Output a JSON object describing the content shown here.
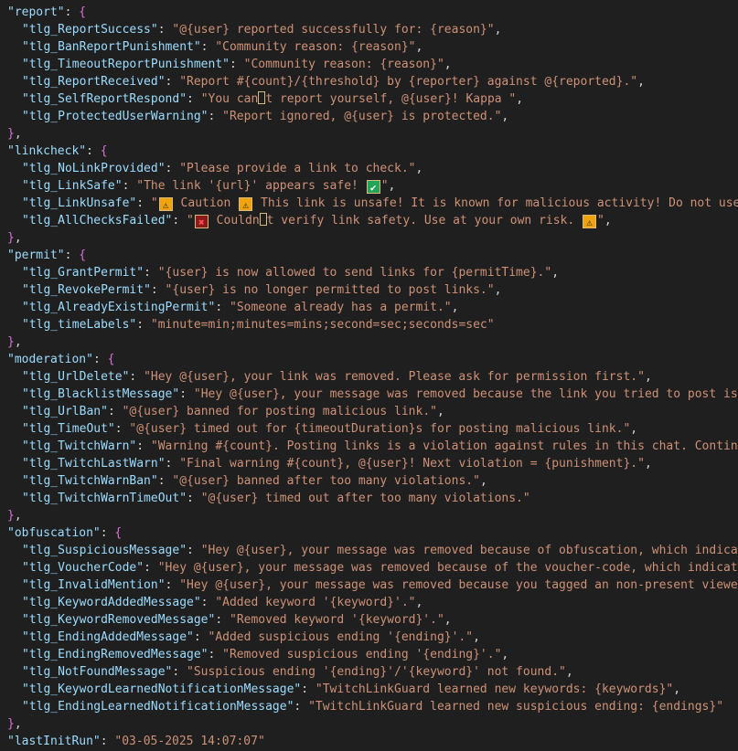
{
  "sections": [
    {
      "key": "report",
      "entries": [
        {
          "key": "tlg_ReportSuccess",
          "parts": [
            {
              "t": "text",
              "v": "@{user} reported successfully for: {reason}"
            }
          ]
        },
        {
          "key": "tlg_BanReportPunishment",
          "parts": [
            {
              "t": "text",
              "v": "Community reason: {reason}"
            }
          ]
        },
        {
          "key": "tlg_TimeoutReportPunishment",
          "parts": [
            {
              "t": "text",
              "v": "Community reason: {reason}"
            }
          ]
        },
        {
          "key": "tlg_ReportReceived",
          "parts": [
            {
              "t": "text",
              "v": "Report #{count}/{threshold} by {reporter} against @{reported}."
            }
          ]
        },
        {
          "key": "tlg_SelfReportRespond",
          "parts": [
            {
              "t": "text",
              "v": "You can"
            },
            {
              "t": "invisible",
              "icon": "invisible-char-icon"
            },
            {
              "t": "text",
              "v": "t report yourself, @{user}! Kappa "
            }
          ]
        },
        {
          "key": "tlg_ProtectedUserWarning",
          "parts": [
            {
              "t": "text",
              "v": "Report ignored, @{user} is protected."
            }
          ]
        }
      ]
    },
    {
      "key": "linkcheck",
      "entries": [
        {
          "key": "tlg_NoLinkProvided",
          "parts": [
            {
              "t": "text",
              "v": "Please provide a link to check."
            }
          ]
        },
        {
          "key": "tlg_LinkSafe",
          "parts": [
            {
              "t": "text",
              "v": "The link '{url}' appears safe! "
            },
            {
              "t": "emoji",
              "icon": "check-mark-icon",
              "glyph": "✔",
              "style": "check"
            }
          ]
        },
        {
          "key": "tlg_LinkUnsafe",
          "parts": [
            {
              "t": "emoji",
              "icon": "warning-icon",
              "glyph": "⚠",
              "style": "warn"
            },
            {
              "t": "text",
              "v": " Caution "
            },
            {
              "t": "emoji",
              "icon": "warning-icon",
              "glyph": "⚠",
              "style": "warn"
            },
            {
              "t": "text",
              "v": " This link is unsafe! It is known for malicious activity! Do not use"
            }
          ],
          "open_end": true
        },
        {
          "key": "tlg_AllChecksFailed",
          "parts": [
            {
              "t": "emoji",
              "icon": "cross-mark-icon",
              "glyph": "✖",
              "style": "cross"
            },
            {
              "t": "text",
              "v": " Couldn"
            },
            {
              "t": "invisible",
              "icon": "invisible-char-icon"
            },
            {
              "t": "text",
              "v": "t verify link safety. Use at your own risk. "
            },
            {
              "t": "emoji",
              "icon": "warning-icon",
              "glyph": "⚠",
              "style": "warn"
            }
          ]
        }
      ]
    },
    {
      "key": "permit",
      "entries": [
        {
          "key": "tlg_GrantPermit",
          "parts": [
            {
              "t": "text",
              "v": "{user} is now allowed to send links for {permitTime}."
            }
          ]
        },
        {
          "key": "tlg_RevokePermit",
          "parts": [
            {
              "t": "text",
              "v": "{user} is no longer permitted to post links."
            }
          ]
        },
        {
          "key": "tlg_AlreadyExistingPermit",
          "parts": [
            {
              "t": "text",
              "v": "Someone already has a permit."
            }
          ]
        },
        {
          "key": "tlg_timeLabels",
          "parts": [
            {
              "t": "text",
              "v": "minute=min;minutes=mins;second=sec;seconds=sec"
            }
          ],
          "last": true
        }
      ]
    },
    {
      "key": "moderation",
      "entries": [
        {
          "key": "tlg_UrlDelete",
          "parts": [
            {
              "t": "text",
              "v": "Hey @{user}, your link was removed. Please ask for permission first."
            }
          ]
        },
        {
          "key": "tlg_BlacklistMessage",
          "parts": [
            {
              "t": "text",
              "v": "Hey @{user}, your message was removed because the link you tried to post is B"
            }
          ],
          "open_end": true
        },
        {
          "key": "tlg_UrlBan",
          "parts": [
            {
              "t": "text",
              "v": "@{user} banned for posting malicious link."
            }
          ]
        },
        {
          "key": "tlg_TimeOut",
          "parts": [
            {
              "t": "text",
              "v": "@{user} timed out for {timeoutDuration}s for posting malicious link."
            }
          ]
        },
        {
          "key": "tlg_TwitchWarn",
          "parts": [
            {
              "t": "text",
              "v": "Warning #{count}. Posting links is a violation against rules in this chat. Continui"
            }
          ],
          "open_end": true
        },
        {
          "key": "tlg_TwitchLastWarn",
          "parts": [
            {
              "t": "text",
              "v": "Final warning #{count}, @{user}! Next violation = {punishment}."
            }
          ]
        },
        {
          "key": "tlg_TwitchWarnBan",
          "parts": [
            {
              "t": "text",
              "v": "@{user} banned after too many violations."
            }
          ]
        },
        {
          "key": "tlg_TwitchWarnTimeOut",
          "parts": [
            {
              "t": "text",
              "v": "@{user} timed out after too many violations."
            }
          ],
          "last": true
        }
      ]
    },
    {
      "key": "obfuscation",
      "entries": [
        {
          "key": "tlg_SuspiciousMessage",
          "parts": [
            {
              "t": "text",
              "v": "Hey @{user}, your message was removed because of obfuscation, which indicate"
            }
          ],
          "open_end": true
        },
        {
          "key": "tlg_VoucherCode",
          "parts": [
            {
              "t": "text",
              "v": "Hey @{user}, your message was removed because of the voucher-code, which indicates"
            }
          ],
          "open_end": true
        },
        {
          "key": "tlg_InvalidMention",
          "parts": [
            {
              "t": "text",
              "v": "Hey @{user}, your message was removed because you tagged an non-present viewer,"
            }
          ],
          "open_end": true
        },
        {
          "key": "tlg_KeywordAddedMessage",
          "parts": [
            {
              "t": "text",
              "v": "Added keyword '{keyword}'."
            }
          ]
        },
        {
          "key": "tlg_KeywordRemovedMessage",
          "parts": [
            {
              "t": "text",
              "v": "Removed keyword '{keyword}'."
            }
          ]
        },
        {
          "key": "tlg_EndingAddedMessage",
          "parts": [
            {
              "t": "text",
              "v": "Added suspicious ending '{ending}'."
            }
          ]
        },
        {
          "key": "tlg_EndingRemovedMessage",
          "parts": [
            {
              "t": "text",
              "v": "Removed suspicious ending '{ending}'."
            }
          ]
        },
        {
          "key": "tlg_NotFoundMessage",
          "parts": [
            {
              "t": "text",
              "v": "Suspicious ending '{ending}'/'{keyword}' not found."
            }
          ]
        },
        {
          "key": "tlg_KeywordLearnedNotificationMessage",
          "parts": [
            {
              "t": "text",
              "v": "TwitchLinkGuard learned new keywords: {keywords}"
            }
          ]
        },
        {
          "key": "tlg_EndingLearnedNotificationMessage",
          "parts": [
            {
              "t": "text",
              "v": "TwitchLinkGuard learned new suspicious ending: {endings}"
            }
          ],
          "last": true
        }
      ]
    }
  ],
  "trailing": {
    "key": "lastInitRun",
    "value": "03-05-2025 14:07:07"
  },
  "colors": {
    "background": "#1f1f1f",
    "key": "#9cdcfe",
    "string": "#ce9178",
    "punctuation": "#d4d4d4",
    "brace": "#da70d6",
    "warning": "#f0a30a",
    "check": "#23a559",
    "cross": "#8b1a1a"
  }
}
